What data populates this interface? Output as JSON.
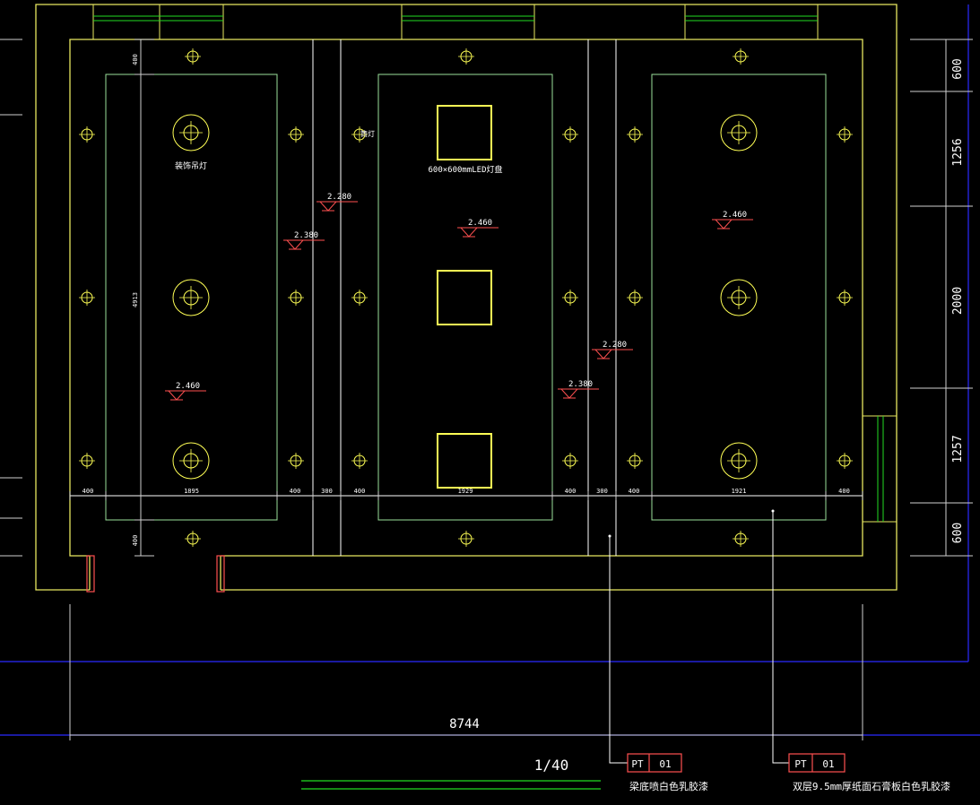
{
  "drawing": {
    "scale": "1/40",
    "overall_width": "8744",
    "right_dims": [
      "600",
      "1256",
      "2000",
      "1257",
      "600"
    ],
    "bottom_row_dims": [
      "400",
      "1895",
      "400",
      "300",
      "400",
      "1929",
      "400",
      "300",
      "400",
      "1921",
      "400"
    ],
    "left_dims": [
      "400",
      "4913",
      "400"
    ],
    "labels": {
      "pendant_lamp": "装饰吊灯",
      "led_panel": "600×600mmLED灯盘",
      "downlight": "筒灯"
    },
    "elevations": {
      "left_panel": "2.460",
      "center_panel": "2.460",
      "right_panel": "2.460",
      "beam_left_top": "2.280",
      "beam_left_low": "2.380",
      "beam_right_top": "2.280",
      "beam_right_low": "2.380"
    },
    "callouts": [
      {
        "tag": "PT",
        "code": "01",
        "note": "梁底喷白色乳胶漆"
      },
      {
        "tag": "PT",
        "code": "01",
        "note": "双层9.5mm厚纸面石膏板白色乳胶漆"
      }
    ],
    "colors": {
      "background": "#000000",
      "wall": "#e8e860",
      "ceiling_line": "#ffffff",
      "panel_outline": "#9adf9a",
      "fixture": "#ffff55",
      "elevation_mark": "#ff5050",
      "grid_line": "#2a2aff",
      "green_line": "#22dd22",
      "dim_line": "#cfcfcf"
    }
  }
}
